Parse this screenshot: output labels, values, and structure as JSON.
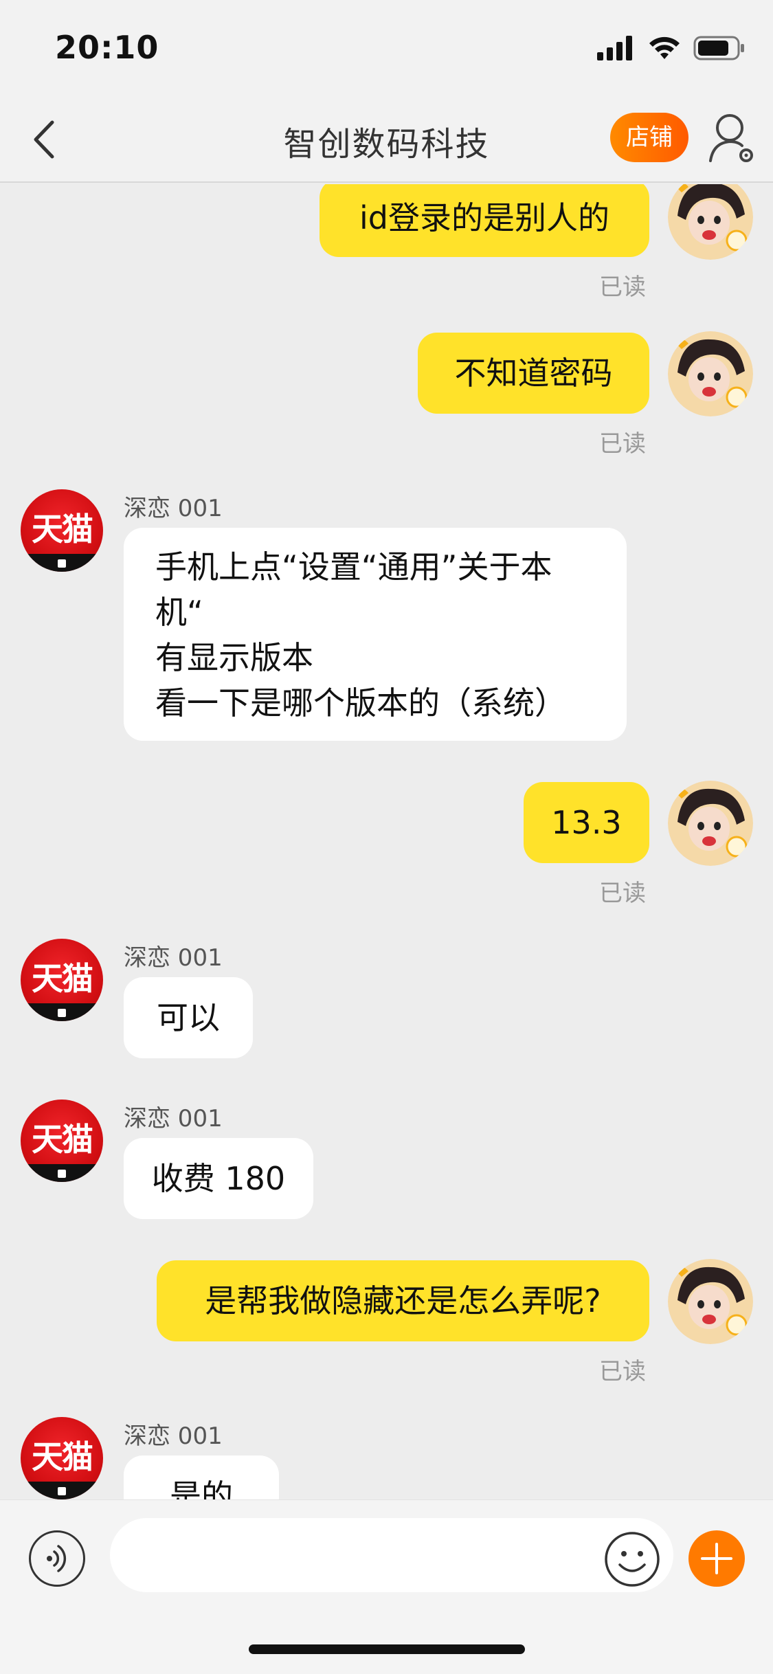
{
  "status_bar": {
    "time": "20:10"
  },
  "header": {
    "title": "智创数码科技",
    "shop_label": "店铺",
    "back_icon": "chevron-left-icon",
    "profile_icon": "user-settings-icon"
  },
  "messages": [
    {
      "side": "me",
      "text": "id登录的是别人的",
      "read": "已读"
    },
    {
      "side": "me",
      "text": "不知道密码",
      "read": "已读"
    },
    {
      "side": "them",
      "sender": "深恋 001",
      "lines": [
        "手机上点“设置“通用”关于本",
        "机“",
        "有显示版本",
        "看一下是哪个版本的（系统）"
      ]
    },
    {
      "side": "me",
      "text": "13.3",
      "read": "已读"
    },
    {
      "side": "them",
      "sender": "深恋 001",
      "lines": [
        "可以"
      ]
    },
    {
      "side": "them",
      "sender": "深恋 001",
      "lines": [
        "收费 180"
      ]
    },
    {
      "side": "me",
      "text": "是帮我做隐藏还是怎么弄呢?",
      "read": "已读"
    },
    {
      "side": "them",
      "sender": "深恋 001",
      "lines": [
        "是的"
      ]
    }
  ],
  "avatar": {
    "tmall_text": "天猫"
  },
  "input": {
    "placeholder": ""
  },
  "colors": {
    "my_bubble": "#ffe22a",
    "their_bubble": "#ffffff",
    "accent": "#ff7a00"
  }
}
